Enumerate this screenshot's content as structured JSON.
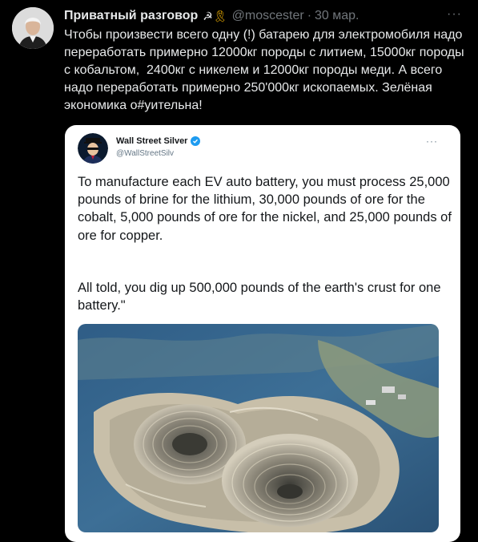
{
  "tweet": {
    "author_name": "Приватный разговор",
    "author_emoji_1": "☭",
    "author_emoji_2": "🎗",
    "handle": "@moscester",
    "separator": "·",
    "date": "30 мар.",
    "more": "···",
    "text": "Чтобы произвести всего одну (!) батарею для электромобиля надо переработать примерно 12000кг породы с литием, 15000кг породы с кобальтом,  2400кг с никелем и 12000кг породы меди. А всего надо переработать примерно 250'000кг ископаемых. Зелёная экономика о#уительна!"
  },
  "quoted": {
    "author_name": "Wall Street Silver",
    "handle": "@WallStreetSilv",
    "more": "···",
    "text_1": "To manufacture each EV auto battery, you must process 25,000 pounds of brine for the lithium, 30,000 pounds of ore for the cobalt, 5,000 pounds of ore for the nickel, and 25,000 pounds of ore for copper.",
    "text_2": "All told, you dig up 500,000 pounds of the earth's crust for one battery.\"",
    "image": "open-pit-mine-aerial-photo"
  },
  "colors": {
    "background": "#000000",
    "text_primary": "#e7e9ea",
    "text_secondary": "#71767b",
    "verified": "#1d9bf0",
    "card_bg": "#ffffff"
  }
}
